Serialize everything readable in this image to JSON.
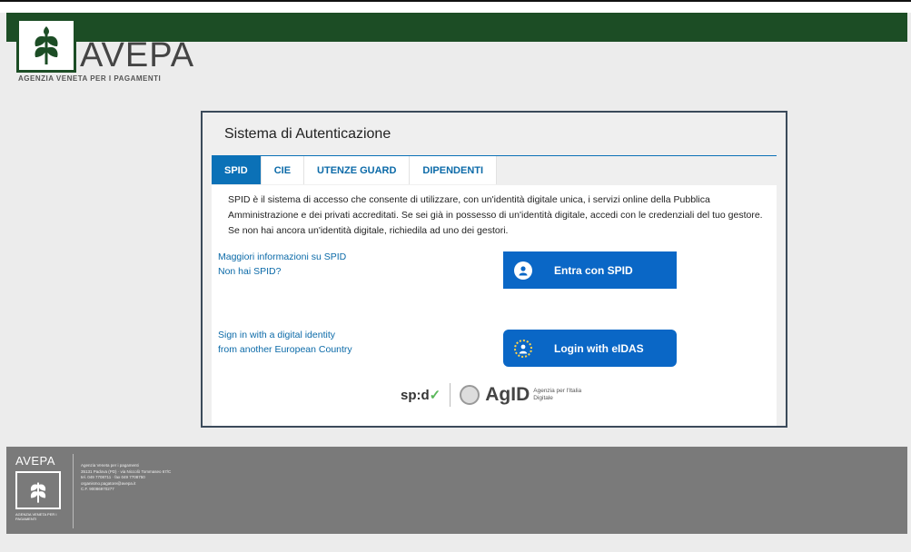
{
  "brand": {
    "name": "AVEPA",
    "subtitle": "AGENZIA VENETA PER I PAGAMENTI",
    "accent": "#1c4d25"
  },
  "auth": {
    "title": "Sistema di Autenticazione",
    "tabs": [
      {
        "label": "SPID",
        "active": true
      },
      {
        "label": "CIE",
        "active": false
      },
      {
        "label": "UTENZE GUARD",
        "active": false
      },
      {
        "label": "DIPENDENTI",
        "active": false
      }
    ],
    "description": "SPID è il sistema di accesso che consente di utilizzare, con un'identità digitale unica, i servizi online della Pubblica Amministrazione e dei privati accreditati. Se sei già in possesso di un'identità digitale, accedi con le credenziali del tuo gestore. Se non hai ancora un'identità digitale, richiedila ad uno dei gestori.",
    "links": {
      "more_info": "Maggiori informazioni su SPID",
      "no_spid": "Non hai SPID?",
      "eidas_line1": "Sign in with a digital identity",
      "eidas_line2": "from another European Country"
    },
    "buttons": {
      "spid": "Entra con SPID",
      "eidas": "Login with eIDAS"
    },
    "logos": {
      "spid": "sp:d",
      "agid": "AgID",
      "agid_sub": "Agenzia per l'Italia Digitale"
    },
    "button_color": "#0a67c6"
  },
  "footer": {
    "logo": "AVEPA",
    "logo_sub": "AGENZIA VENETA PER I PAGAMENTI",
    "info": [
      "Agenzia Veneta per i pagamenti",
      "35131 Padova (PD) · via Niccolò Tommaseo 67/C",
      "tel. 049 7708711 · fax 049 7708750",
      "organismo.pagatore@avepa.it",
      "C.F. 90086970277"
    ]
  }
}
